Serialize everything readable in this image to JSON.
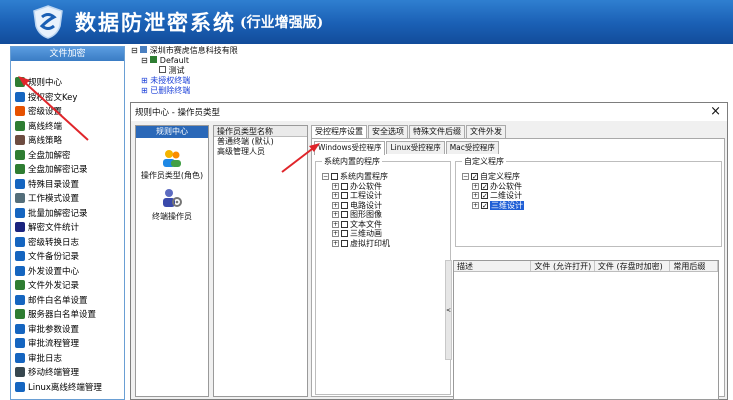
{
  "header": {
    "title": "数据防泄密系统",
    "edition": "(行业增强版)"
  },
  "sidebar": {
    "heading": "文件加密",
    "items": [
      {
        "label": "规则中心",
        "icon": "rules-icon",
        "color": "#2e7d32"
      },
      {
        "label": "授权密文Key",
        "icon": "key-icon",
        "color": "#1565c0"
      },
      {
        "label": "密级设置",
        "icon": "lock-icon",
        "color": "#e65100"
      },
      {
        "label": "离线终端",
        "icon": "offline-icon",
        "color": "#2e7d32"
      },
      {
        "label": "离线策略",
        "icon": "policy-icon",
        "color": "#6d4c41"
      },
      {
        "label": "全盘加解密",
        "icon": "disk-icon",
        "color": "#2e7d32"
      },
      {
        "label": "全盘加解密记录",
        "icon": "disk-log-icon",
        "color": "#2e7d32"
      },
      {
        "label": "特殊目录设置",
        "icon": "folder-gear-icon",
        "color": "#1565c0"
      },
      {
        "label": "工作模式设置",
        "icon": "mode-icon",
        "color": "#546e7a"
      },
      {
        "label": "批量加解密记录",
        "icon": "batch-icon",
        "color": "#1565c0"
      },
      {
        "label": "解密文件统计",
        "icon": "stats-icon",
        "color": "#1a237e"
      },
      {
        "label": "密级转换日志",
        "icon": "log-icon",
        "color": "#1565c0"
      },
      {
        "label": "文件备份记录",
        "icon": "backup-icon",
        "color": "#1565c0"
      },
      {
        "label": "外发设置中心",
        "icon": "send-settings-icon",
        "color": "#1565c0"
      },
      {
        "label": "文件外发记录",
        "icon": "send-log-icon",
        "color": "#2e7d32"
      },
      {
        "label": "邮件白名单设置",
        "icon": "mail-icon",
        "color": "#1565c0"
      },
      {
        "label": "服务器白名单设置",
        "icon": "server-icon",
        "color": "#2e7d32"
      },
      {
        "label": "审批参数设置",
        "icon": "approval-params-icon",
        "color": "#1565c0"
      },
      {
        "label": "审批流程管理",
        "icon": "workflow-icon",
        "color": "#1565c0"
      },
      {
        "label": "审批日志",
        "icon": "approval-log-icon",
        "color": "#1565c0"
      },
      {
        "label": "移动终端管理",
        "icon": "mobile-icon",
        "color": "#37474f"
      },
      {
        "label": "Linux离线终端管理",
        "icon": "linux-icon",
        "color": "#1565c0"
      }
    ]
  },
  "bg_tree": {
    "company": "深圳市赛虎信息科技有限",
    "group": "Default",
    "child": "测试",
    "unauthorized": "未授权终端",
    "deleted": "已删除终端"
  },
  "dialog": {
    "title": "规则中心 - 操作员类型",
    "close_glyph": "×",
    "left_heading": "规则中心",
    "role_types_label": "操作员类型(角色)",
    "operators_label": "终端操作员",
    "type_table": {
      "header": "操作员类型名称",
      "rows": [
        "普通终端 (默认)",
        "高级管理人员"
      ]
    },
    "tabs": [
      "受控程序设置",
      "安全选项",
      "特殊文件后缀",
      "文件外发"
    ],
    "sub_tabs": [
      "Windows受控程序",
      "Linux受控程序",
      "Mac受控程序"
    ],
    "builtin_group": {
      "label": "系统内置的程序",
      "root": "系统内置程序",
      "children": [
        "办公软件",
        "工程设计",
        "电路设计",
        "图形图像",
        "文本文件",
        "三维动画",
        "虚拟打印机"
      ]
    },
    "custom_group": {
      "label": "自定义程序",
      "root": "自定义程序",
      "children": [
        "办公软件",
        "二维设计",
        "三维设计"
      ]
    },
    "rule_table": {
      "columns": [
        "描述",
        "文件 (允许打开)",
        "文件 (存盘时加密)",
        "常用后缀"
      ]
    },
    "splitter_glyph": "<"
  },
  "colors": {
    "header": "#1a5fb4",
    "accent_red": "#e0252a",
    "selection": "#1f5fd6"
  }
}
